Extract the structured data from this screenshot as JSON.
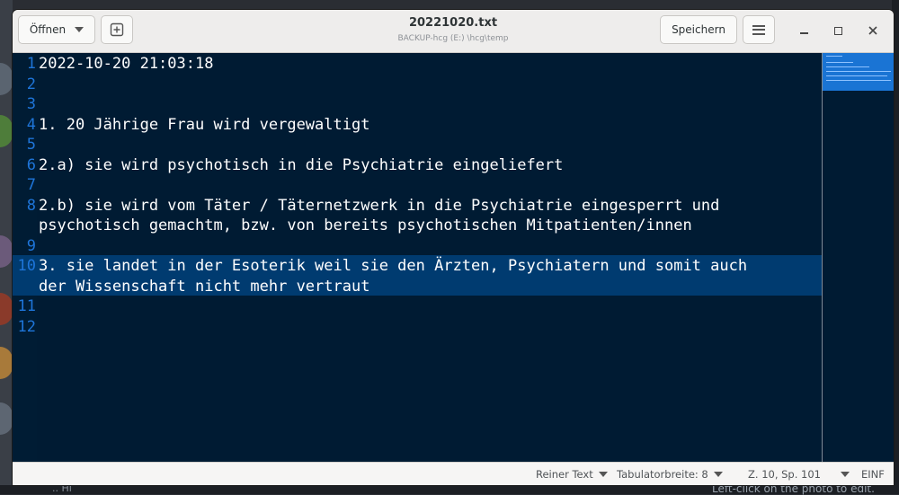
{
  "window": {
    "title": "20221020.txt",
    "subtitle": "BACKUP-hcg (E:) \\hcg\\temp",
    "open_label": "Öffnen",
    "save_label": "Speichern"
  },
  "editor": {
    "current_line": 10,
    "lines": [
      {
        "n": "1",
        "text": "2022-10-20 21:03:18"
      },
      {
        "n": "2",
        "text": ""
      },
      {
        "n": "3",
        "text": ""
      },
      {
        "n": "4",
        "text": "1. 20 Jährige Frau wird vergewaltigt"
      },
      {
        "n": "5",
        "text": ""
      },
      {
        "n": "6",
        "text": "2.a) sie wird psychotisch in die Psychiatrie eingeliefert"
      },
      {
        "n": "7",
        "text": ""
      },
      {
        "n": "8",
        "text": "2.b) sie wird vom Täter / Täternetzwerk in die Psychiatrie eingesperrt und"
      },
      {
        "n": "",
        "text": "psychotisch gemachtm, bzw. von bereits psychotischen Mitpatienten/innen"
      },
      {
        "n": "9",
        "text": ""
      },
      {
        "n": "10",
        "text": "3. sie landet in der Esoterik weil sie den Ärzten, Psychiatern und somit auch"
      },
      {
        "n": "",
        "text": "der Wissenschaft nicht mehr vertraut"
      },
      {
        "n": "11",
        "text": ""
      },
      {
        "n": "12",
        "text": ""
      }
    ]
  },
  "statusbar": {
    "language": "Reiner Text",
    "tab_width": "Tabulatorbreite: 8",
    "position": "Z. 10, Sp. 101",
    "mode": "EINF"
  },
  "desktop": {
    "caption": "Left-click on the photo to edit.",
    "hi": ".. Hi"
  },
  "colors": {
    "editor_bg": "#001b33",
    "line_number": "#1e75d9",
    "current_line_bg": "#003b70",
    "minimap_view": "#1a74d4"
  },
  "icons": {
    "open_dropdown": "chevron-down-icon",
    "new_tab": "new-tab-icon",
    "menu": "hamburger-icon",
    "minimize": "minimize-icon",
    "maximize": "maximize-icon",
    "close": "close-icon"
  }
}
